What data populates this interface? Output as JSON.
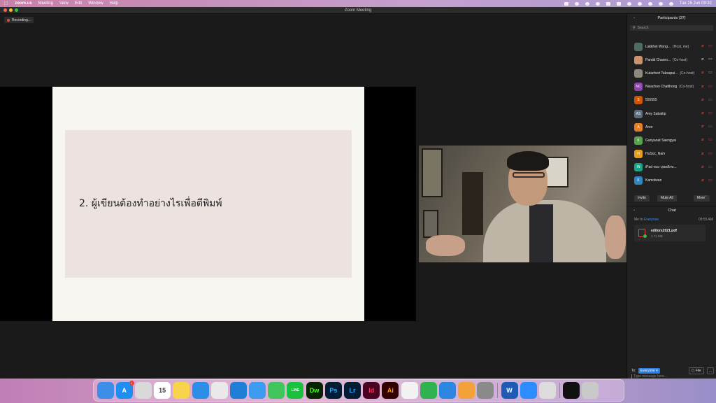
{
  "menubar": {
    "app": "zoom.us",
    "menus": [
      "Meeting",
      "View",
      "Edit",
      "Window",
      "Help"
    ],
    "datetime": "Tue 15 Jun  09:32"
  },
  "window": {
    "title": "Zoom Meeting"
  },
  "recording": {
    "label": "Recording..."
  },
  "slide": {
    "text": "2. ผู้เขียนต้องทำอย่างไรเพื่อตีพิมพ์"
  },
  "participants": {
    "title": "Participants (37)",
    "search_placeholder": "Search",
    "list": [
      {
        "initials": "",
        "name": "Lakkhet Wong...",
        "role": "(Host, me)",
        "color": "#4f6b66",
        "mic": "off",
        "cam": "off"
      },
      {
        "initials": "",
        "name": "Pandit Chanro...",
        "role": "(Co-host)",
        "color": "#c99370",
        "mic": "on",
        "cam": "on"
      },
      {
        "initials": "",
        "name": "Kulachert Taksapai...",
        "role": "(Co-host)",
        "color": "#8f8a80",
        "mic": "off",
        "cam": "on"
      },
      {
        "initials": "NC",
        "name": "Nisachon Chatthong",
        "role": "(Co-host)",
        "color": "#8e44ad",
        "mic": "off",
        "cam": "off"
      },
      {
        "initials": "S",
        "name": "555555",
        "role": "",
        "color": "#d35400",
        "mic": "off",
        "cam": "off"
      },
      {
        "initials": "AS",
        "name": "Amy Sabaitip",
        "role": "",
        "color": "#5d6d7e",
        "mic": "off",
        "cam": "off"
      },
      {
        "initials": "A",
        "name": "Aree",
        "role": "",
        "color": "#e67e22",
        "mic": "off",
        "cam": "off"
      },
      {
        "initials": "K",
        "name": "Ganyanat Saengyai",
        "role": "",
        "color": "#58a14e",
        "mic": "off",
        "cam": "off"
      },
      {
        "initials": "H",
        "name": "HuSoc_Nam",
        "role": "",
        "color": "#e59e1b",
        "mic": "off",
        "cam": "off"
      },
      {
        "initials": "IN",
        "name": "iPad ของ บุษยลักษ...",
        "role": "",
        "color": "#17a589",
        "mic": "off",
        "cam": "off"
      },
      {
        "initials": "K",
        "name": "Kamolwan",
        "role": "",
        "color": "#2e86c1",
        "mic": "off",
        "cam": "off"
      }
    ],
    "actions": {
      "invite": "Invite",
      "mute_all": "Mute All",
      "more": "More"
    }
  },
  "chat": {
    "title": "Chat",
    "from": "Me to",
    "to_target": "Everyone",
    "time": "09:55 AM",
    "file": {
      "name": "editors2021.pdf",
      "size": "1.71 MB"
    },
    "to_label": "To:",
    "to_select": "Everyone",
    "file_button": "File",
    "more_button": "...",
    "input_placeholder": "Type message here..."
  },
  "dock": {
    "apps": [
      {
        "name": "finder",
        "label": "",
        "bg": "#3d8ee8"
      },
      {
        "name": "app-store",
        "label": "A",
        "bg": "#1f8ef1",
        "badge": "1"
      },
      {
        "name": "launchpad",
        "label": "",
        "bg": "#d9d9d9"
      },
      {
        "name": "calendar",
        "label": "15",
        "bg": "#ffffff"
      },
      {
        "name": "notes",
        "label": "",
        "bg": "#f7d44a"
      },
      {
        "name": "safari",
        "label": "",
        "bg": "#2d8ee8"
      },
      {
        "name": "chrome",
        "label": "",
        "bg": "#e9e9e9"
      },
      {
        "name": "edge",
        "label": "",
        "bg": "#1f7fd6"
      },
      {
        "name": "mail",
        "label": "",
        "bg": "#3e9cf0"
      },
      {
        "name": "facetime",
        "label": "",
        "bg": "#3fc55b"
      },
      {
        "name": "line",
        "label": "LINE",
        "bg": "#18c13e"
      },
      {
        "name": "dreamweaver",
        "label": "Dw",
        "bg": "#072401"
      },
      {
        "name": "photoshop",
        "label": "Ps",
        "bg": "#001d34"
      },
      {
        "name": "lightroom",
        "label": "Lr",
        "bg": "#001d34"
      },
      {
        "name": "indesign",
        "label": "Id",
        "bg": "#49021f"
      },
      {
        "name": "illustrator",
        "label": "Ai",
        "bg": "#330000"
      },
      {
        "name": "photos",
        "label": "",
        "bg": "#f2f2f2"
      },
      {
        "name": "numbers",
        "label": "",
        "bg": "#2fb24f"
      },
      {
        "name": "keynote",
        "label": "",
        "bg": "#2d86e0"
      },
      {
        "name": "pages",
        "label": "",
        "bg": "#f3a23a"
      },
      {
        "name": "system-preferences",
        "label": "",
        "bg": "#8a8a8a"
      },
      {
        "name": "word",
        "label": "W",
        "bg": "#1f5bb5"
      },
      {
        "name": "zoom",
        "label": "",
        "bg": "#2d8cff"
      },
      {
        "name": "preview",
        "label": "",
        "bg": "#dcdcdc"
      },
      {
        "name": "terminal-window",
        "label": "",
        "bg": "#111111"
      },
      {
        "name": "trash",
        "label": "",
        "bg": "#c9c9c9"
      }
    ]
  }
}
